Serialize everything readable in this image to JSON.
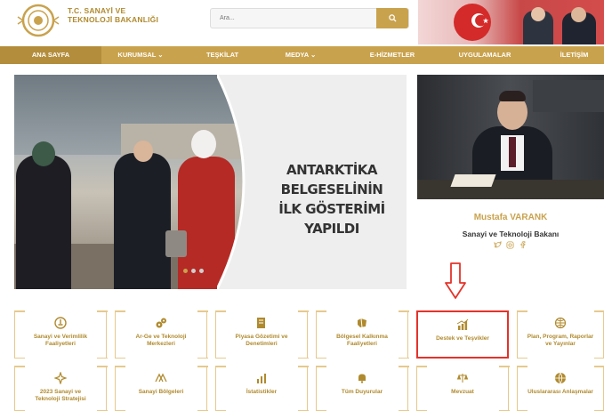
{
  "header": {
    "brand_line1": "T.C. SANAYİ VE",
    "brand_line2": "TEKNOLOJİ BAKANLIĞI",
    "search_placeholder": "Ara..."
  },
  "nav": {
    "items": [
      {
        "label": "ANA SAYFA"
      },
      {
        "label": "KURUMSAL ⌄"
      },
      {
        "label": "TEŞKİLAT"
      },
      {
        "label": "MEDYA ⌄"
      },
      {
        "label": "E-HİZMETLER"
      },
      {
        "label": "UYGULAMALAR"
      },
      {
        "label": "İLETİŞİM"
      }
    ]
  },
  "slider": {
    "headline_line1": "ANTARKTİKA BELGESELİNİN",
    "headline_line2": "İLK GÖSTERİMİ YAPILDI"
  },
  "minister": {
    "name": "Mustafa VARANK",
    "title": "Sanayi ve Teknoloji Bakanı"
  },
  "tiles": [
    {
      "label_line1": "Sanayi ve Verimlilik",
      "label_line2": "Faaliyetleri"
    },
    {
      "label_line1": "Ar-Ge ve Teknoloji",
      "label_line2": "Merkezleri"
    },
    {
      "label_line1": "Piyasa Gözetimi ve",
      "label_line2": "Denetimleri"
    },
    {
      "label_line1": "Bölgesel Kalkınma",
      "label_line2": "Faaliyetleri"
    },
    {
      "label_line1": "Destek ve Teşvikler",
      "label_line2": ""
    },
    {
      "label_line1": "Plan, Program, Raporlar",
      "label_line2": "ve Yayınlar"
    },
    {
      "label_line1": "2023 Sanayi ve",
      "label_line2": "Teknoloji Stratejisi"
    },
    {
      "label_line1": "Sanayi Bölgeleri",
      "label_line2": ""
    },
    {
      "label_line1": "İstatistikler",
      "label_line2": ""
    },
    {
      "label_line1": "Tüm Duyurular",
      "label_line2": ""
    },
    {
      "label_line1": "Mevzuat",
      "label_line2": ""
    },
    {
      "label_line1": "Uluslararası Anlaşmalar",
      "label_line2": ""
    }
  ],
  "colors": {
    "gold": "#c9a24d",
    "highlight_red": "#e4332a"
  }
}
